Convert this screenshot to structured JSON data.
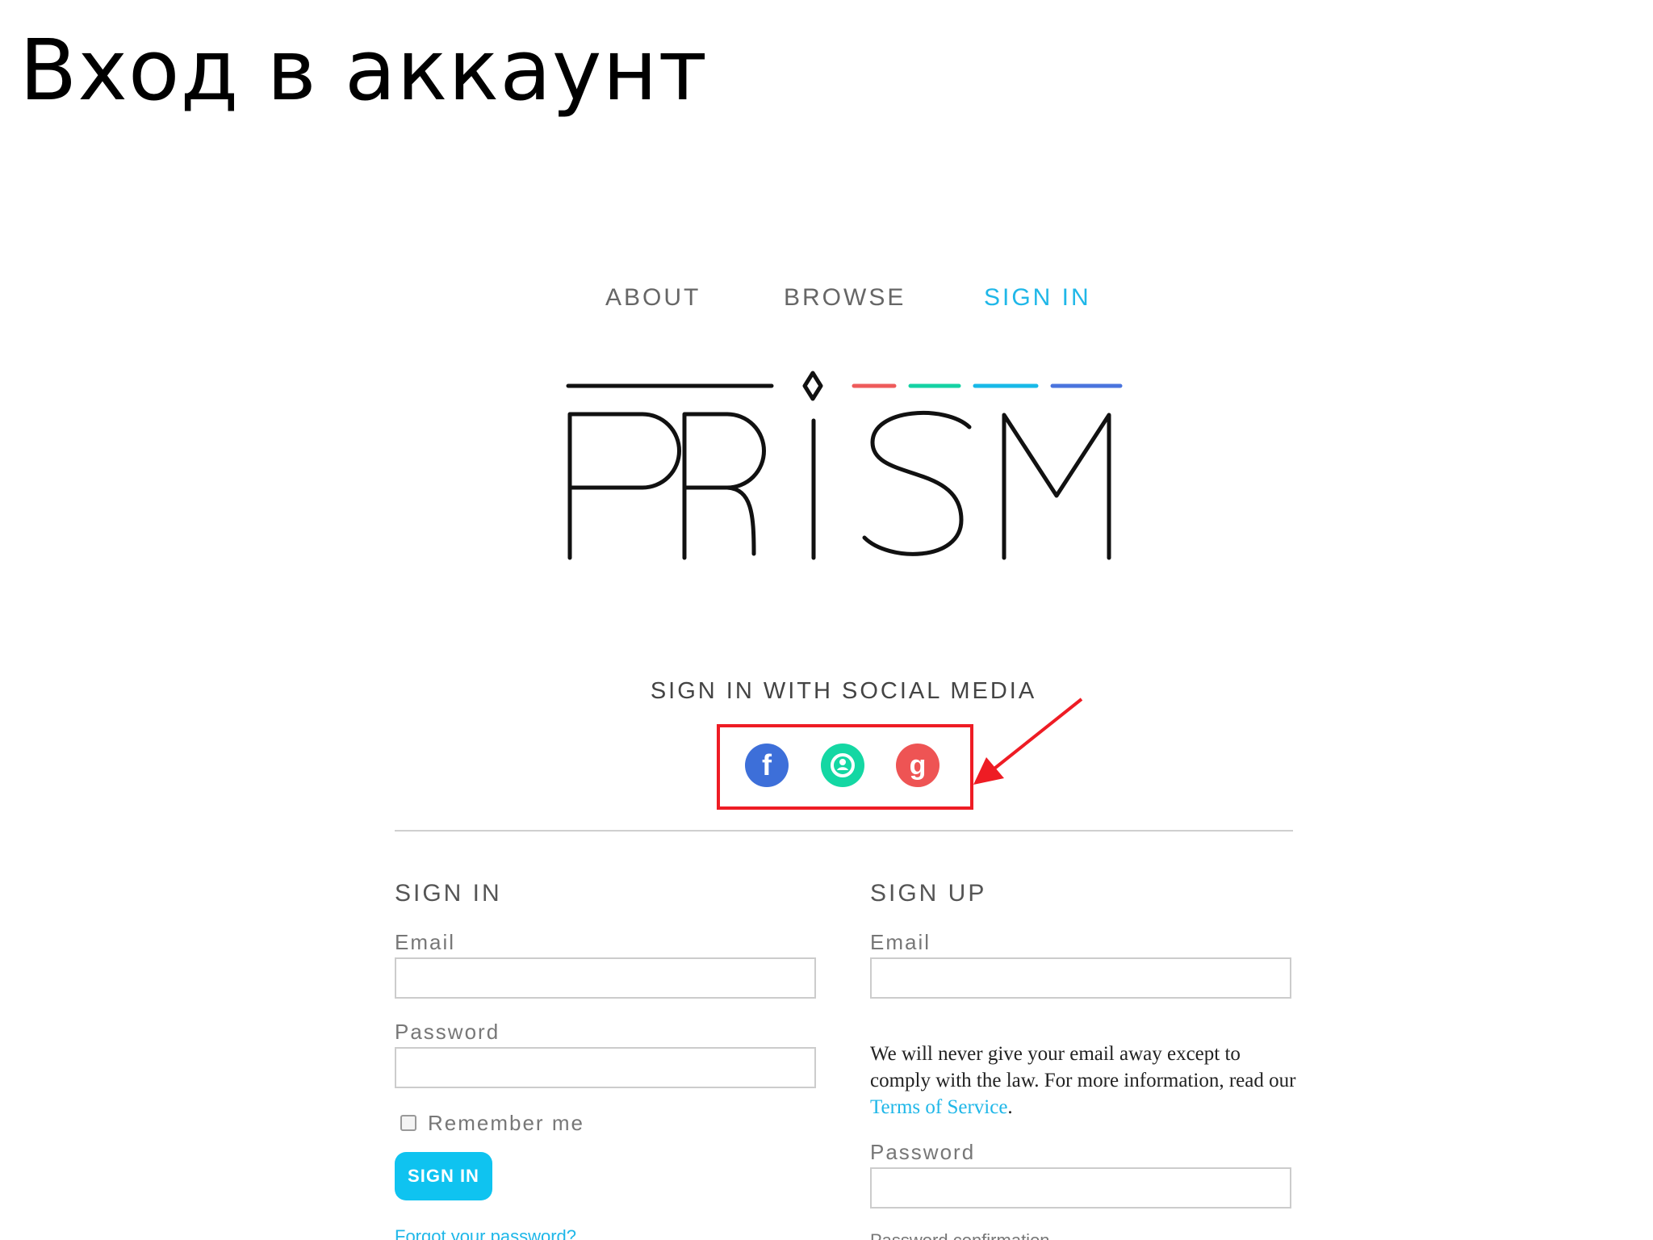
{
  "slide": {
    "title": "Вход в аккаунт"
  },
  "nav": {
    "about": "ABOUT",
    "browse": "BROWSE",
    "sign_in": "SIGN IN"
  },
  "logo": {
    "text": "PRISM",
    "stripe_colors": [
      "#ee5b5b",
      "#15d2a4",
      "#18b9e8",
      "#4a74de"
    ]
  },
  "social": {
    "title": "SIGN IN WITH SOCIAL MEDIA",
    "icons": [
      {
        "name": "facebook-icon",
        "glyph": "f",
        "color": "#3d6fd9"
      },
      {
        "name": "social-network-icon",
        "glyph": "◙",
        "color": "#14d7a3"
      },
      {
        "name": "google-icon",
        "glyph": "g",
        "color": "#ee5454"
      }
    ],
    "highlight_color": "#ee1c24"
  },
  "signin": {
    "title": "SIGN IN",
    "email_label": "Email",
    "password_label": "Password",
    "remember_label": "Remember me",
    "button_label": "SIGN IN",
    "forgot_label": "Forgot your password?"
  },
  "signup": {
    "title": "SIGN UP",
    "email_label": "Email",
    "notice_text": "We will never give your email away except to comply with the law. For more information, read our ",
    "notice_link": "Terms of Service",
    "notice_end": ".",
    "password_label": "Password",
    "partial_text": "Password confirmation"
  }
}
